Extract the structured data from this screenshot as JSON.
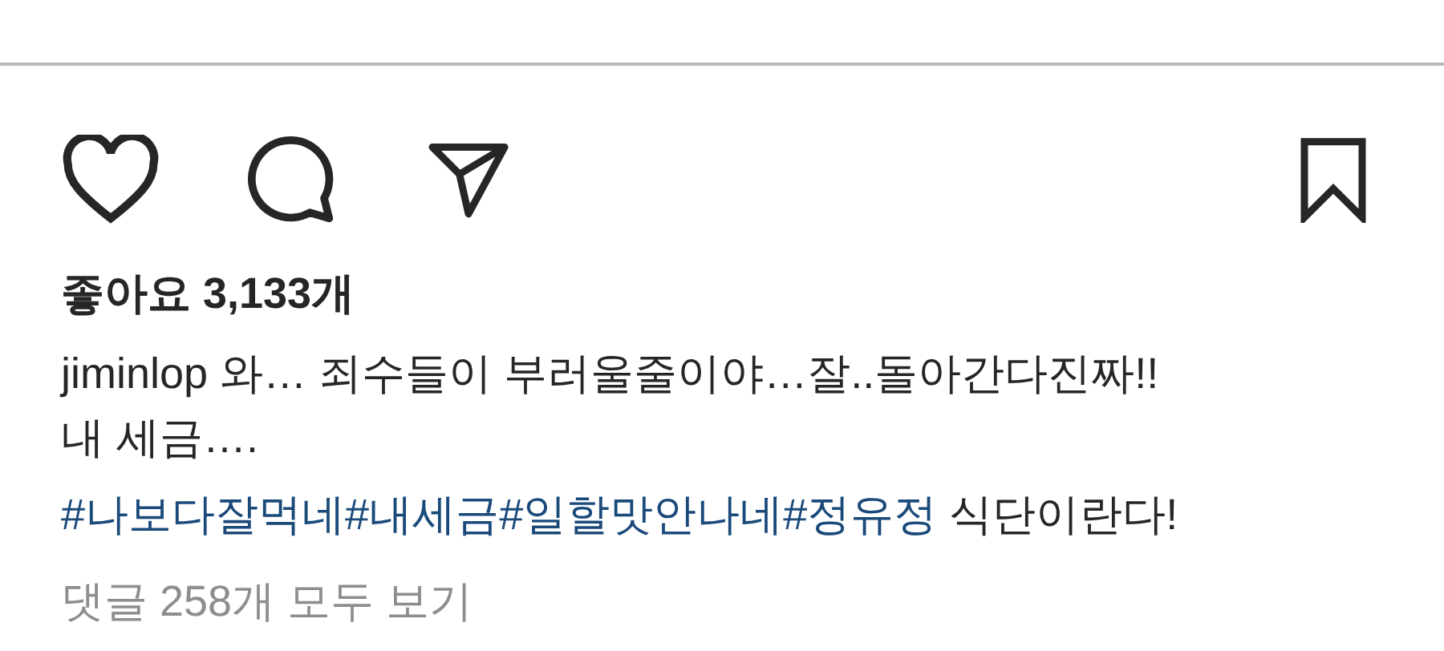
{
  "likes": "좋아요 3,133개",
  "caption": {
    "username": "jiminlop",
    "lines": [
      "와… 죄수들이 부러울줄이야…잘..돌아간다진짜!!",
      "내 세금…."
    ],
    "hashtags": [
      "#나보다잘먹네",
      "#내세금",
      "#일할맛안나네",
      "#정유정"
    ],
    "suffix": "식단이란다!"
  },
  "comments_link": "댓글 258개 모두 보기"
}
